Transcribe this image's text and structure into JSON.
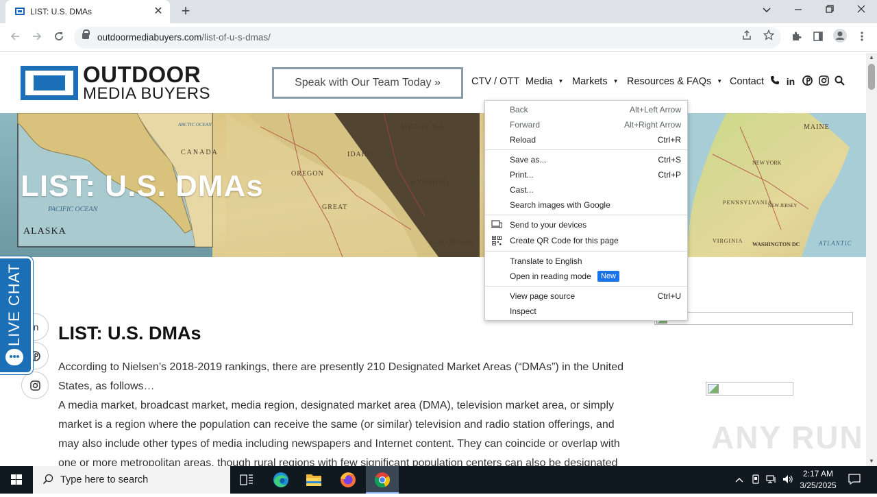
{
  "browser": {
    "tab_title": "LIST: U.S. DMAs",
    "close_glyph": "✕",
    "new_tab_glyph": "+",
    "url_domain": "outdoormediabuyers.com",
    "url_path": "/list-of-u-s-dmas/"
  },
  "site": {
    "logo_line1": "OUTDOOR",
    "logo_line2": "MEDIA BUYERS",
    "cta": "Speak with Our Team Today »",
    "nav": {
      "ctv": "CTV / OTT",
      "media": "Media",
      "markets": "Markets",
      "resources": "Resources & FAQs",
      "contact": "Contact"
    },
    "hero_title": "LIST: U.S. DMAs",
    "hero_map_labels": {
      "alaska": "ALASKA",
      "montana": "MONTANA",
      "oregon": "OREGON",
      "idaho": "IDAHO",
      "wyoming": "WYOMING",
      "colorado": "COLORADO",
      "maine": "MAINE",
      "new_york": "NEW YORK",
      "pennsylvania": "PENNSYLVANIA",
      "new_jersey": "NEW JERSEY",
      "virginia": "VIRGINIA",
      "washington": "WASHINGTON DC",
      "atlantic": "ATLANTIC",
      "canada": "CANADA",
      "arctic": "ARCTIC OCEAN",
      "pacific": "PACIFIC OCEAN",
      "great": "GREAT"
    },
    "live_chat": "LIVE CHAT",
    "content_title": "LIST: U.S. DMAs",
    "para1": "According to Nielsen’s 2018-2019 rankings, there are presently 210 Designated Market Areas (“DMAs”) in the United States, as follows…",
    "para2": "A media market, broadcast market, media region, designated market area (DMA), television market area, or simply market is a region where the population can receive the same (or similar) television and radio station offerings, and may also include other types of media including newspapers and Internet content. They can coincide or overlap with one or more metropolitan areas, though rural regions with few significant population centers can also be designated as markets.",
    "watermark": "ANY RUN"
  },
  "context_menu": {
    "items": [
      {
        "label": "Back",
        "shortcut": "Alt+Left Arrow"
      },
      {
        "label": "Forward",
        "shortcut": "Alt+Right Arrow"
      },
      {
        "label": "Reload",
        "shortcut": "Ctrl+R"
      },
      {
        "label": "Save as...",
        "shortcut": "Ctrl+S"
      },
      {
        "label": "Print...",
        "shortcut": "Ctrl+P"
      },
      {
        "label": "Cast...",
        "shortcut": ""
      },
      {
        "label": "Search images with Google",
        "shortcut": ""
      },
      {
        "label": "Send to your devices",
        "shortcut": ""
      },
      {
        "label": "Create QR Code for this page",
        "shortcut": ""
      },
      {
        "label": "Translate to English",
        "shortcut": ""
      },
      {
        "label": "Open in reading mode",
        "shortcut": ""
      },
      {
        "label": "View page source",
        "shortcut": "Ctrl+U"
      },
      {
        "label": "Inspect",
        "shortcut": ""
      }
    ],
    "new_badge": "New"
  },
  "taskbar": {
    "search_placeholder": "Type here to search",
    "time": "2:17 AM",
    "date": "3/25/2025"
  },
  "colors": {
    "brand_blue": "#1a6fb6",
    "badge_blue": "#1a73e8",
    "taskbar": "#101820"
  }
}
